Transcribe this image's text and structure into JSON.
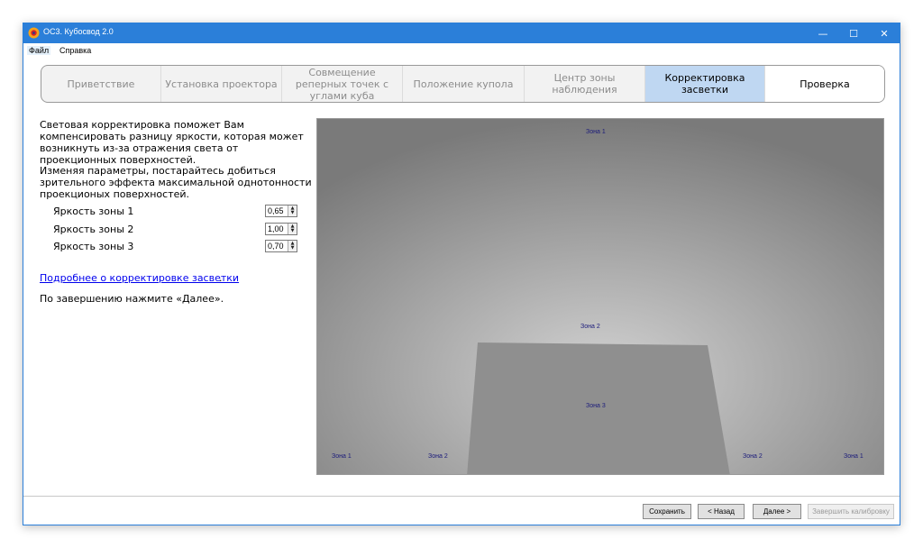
{
  "window": {
    "title": "ОС3. Кубосвод 2.0",
    "controls": {
      "minimize": "—",
      "maximize": "☐",
      "close": "✕"
    }
  },
  "menu": {
    "items": [
      "Файл",
      "Справка"
    ]
  },
  "tabs": [
    {
      "label": "Приветствие",
      "state": "inactive"
    },
    {
      "label": "Установка проектора",
      "state": "inactive"
    },
    {
      "label": "Совмещение реперных точек с углами куба",
      "state": "inactive"
    },
    {
      "label": "Положение купола",
      "state": "inactive"
    },
    {
      "label": "Центр зоны наблюдения",
      "state": "inactive"
    },
    {
      "label": "Корректировка засветки",
      "state": "active"
    },
    {
      "label": "Проверка",
      "state": "enabled"
    }
  ],
  "content": {
    "intro": "Световая корректировка поможет Вам компенсировать разницу яркости, которая может возникнуть из-за отражения света от проекционных поверхностей.",
    "instruction": "Изменяя параметры, постарайтесь добиться зрительного эффекта максимальной однотонности проекционых поверхностей.",
    "params": [
      {
        "label": "Яркость зоны 1",
        "value": "0,65"
      },
      {
        "label": "Яркость зоны 2",
        "value": "1,00"
      },
      {
        "label": "Яркость зоны 3",
        "value": "0,70"
      }
    ],
    "link": "Подробнее о корректировке засветки",
    "link_suffix": ".",
    "finish": "По завершению нажмите «Далее»."
  },
  "zones": {
    "ceiling": "Зона 1",
    "center_wall": "Зона 2",
    "floor": "Зона 3",
    "bottom_left_1": "Зона 1",
    "bottom_left_2": "Зона 2",
    "bottom_right_2": "Зона 2",
    "bottom_right_1": "Зона 1"
  },
  "buttons": {
    "save": "Сохранить",
    "back": "< Назад",
    "next": "Далее >",
    "finish": "Завершить калибровку"
  },
  "colors": {
    "titlebar": "#2b7fd9",
    "active_tab": "#bfd7f2",
    "link": "#0000ee",
    "zone_label": "#1a1a7a"
  }
}
